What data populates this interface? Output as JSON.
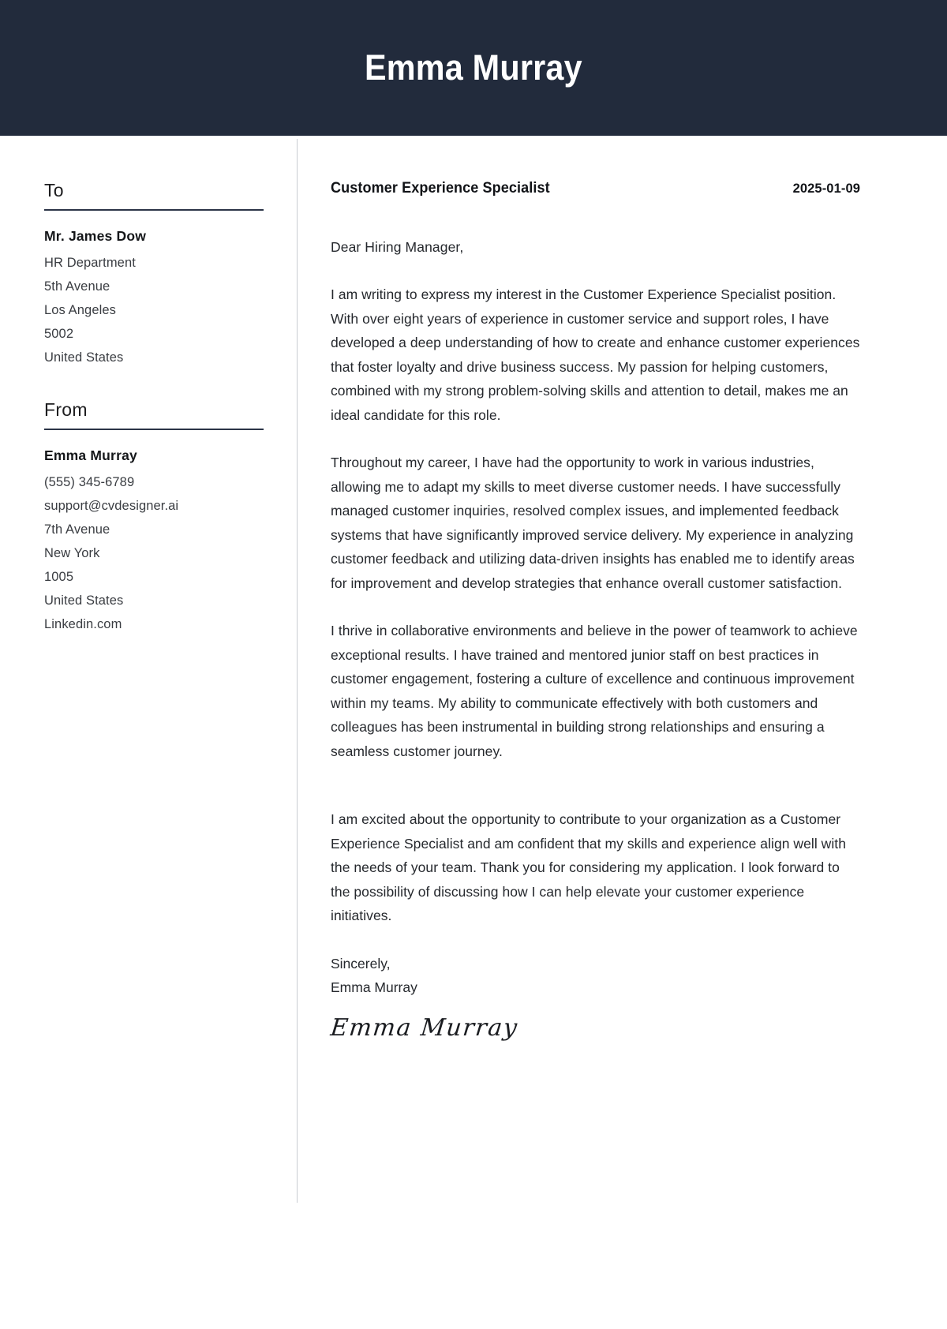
{
  "header": {
    "name": "Emma Murray"
  },
  "sidebar": {
    "to": {
      "heading": "To",
      "recipient_name": "Mr. James Dow",
      "lines": [
        "HR Department",
        "5th Avenue",
        "Los Angeles",
        "5002",
        "United States"
      ]
    },
    "from": {
      "heading": "From",
      "sender_name": "Emma  Murray",
      "lines": [
        "(555) 345-6789",
        "support@cvdesigner.ai",
        "7th Avenue",
        "New York",
        "1005",
        "United States",
        "Linkedin.com"
      ]
    }
  },
  "letter": {
    "job_title": "Customer Experience Specialist",
    "date": "2025-01-09",
    "salutation": "Dear Hiring Manager,",
    "paragraphs": [
      "I am writing to express my interest in the Customer Experience Specialist position. With over eight years of experience in customer service and support roles, I have developed a deep understanding of how to create and enhance customer experiences that foster loyalty and drive business success. My passion for helping customers, combined with my strong problem-solving skills and attention to detail, makes me an ideal candidate for this role.",
      "Throughout my career, I have had the opportunity to work in various industries, allowing me to adapt my skills to meet diverse customer needs. I have successfully managed customer inquiries, resolved complex issues, and implemented feedback systems that have significantly improved service delivery. My experience in analyzing customer feedback and utilizing data-driven insights has enabled me to identify areas for improvement and develop strategies that enhance overall customer satisfaction.",
      "I thrive in collaborative environments and believe in the power of teamwork to achieve exceptional results. I have trained and mentored junior staff on best practices in customer engagement, fostering a culture of excellence and continuous improvement within my teams. My ability to communicate effectively with both customers and colleagues has been instrumental in building strong relationships and ensuring a seamless customer journey.",
      "I am excited about the opportunity to contribute to your organization as a Customer Experience Specialist and am confident that my skills and experience align well with the needs of your team. Thank you for considering my application. I look forward to the possibility of discussing how I can help elevate your customer experience initiatives."
    ],
    "closing": "Sincerely,",
    "closing_name": "Emma Murray",
    "signature": "Emma Murray"
  },
  "colors": {
    "header_bg": "#222b3c",
    "rule": "#2b3447",
    "divider": "#c9ccd2",
    "text": "#25282d"
  }
}
